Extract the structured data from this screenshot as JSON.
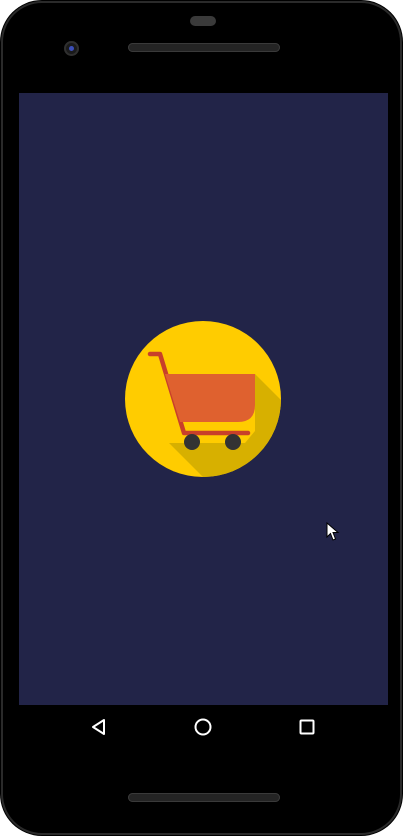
{
  "app": {
    "screen_name": "splash",
    "background_color": "#222448",
    "logo": {
      "icon": "shopping-cart-icon",
      "circle_color": "#FFCC00",
      "cart_color": "#DF612F",
      "handle_color": "#C8402A",
      "wheel_color": "#333333",
      "shadow_color": "#D7B000"
    }
  },
  "device": {
    "frame_color": "#000000"
  },
  "navigation_bar": {
    "buttons": [
      {
        "name": "back",
        "icon": "back-triangle-icon"
      },
      {
        "name": "home",
        "icon": "home-circle-icon"
      },
      {
        "name": "recents",
        "icon": "recents-square-icon"
      }
    ],
    "icon_color": "#FFFFFF"
  },
  "pointer": {
    "icon": "mouse-cursor-icon"
  }
}
